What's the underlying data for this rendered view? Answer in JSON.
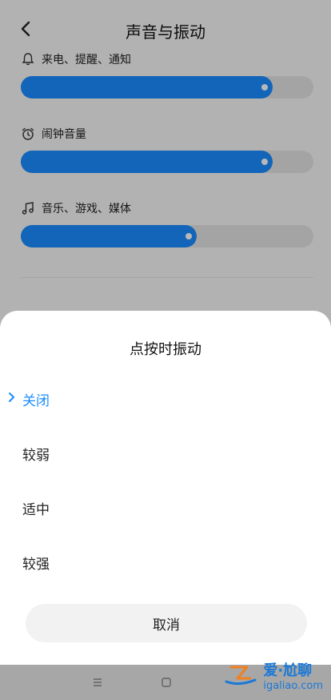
{
  "header": {
    "title": "声音与振动"
  },
  "volume_rows": [
    {
      "label": "来电、提醒、通知",
      "icon": "bell-icon",
      "level": 0.86
    },
    {
      "label": "闹钟音量",
      "icon": "alarm-clock-icon",
      "level": 0.86
    },
    {
      "label": "音乐、游戏、媒体",
      "icon": "music-note-icon",
      "level": 0.6
    }
  ],
  "sheet": {
    "title": "点按时振动",
    "options": [
      {
        "label": "关闭",
        "selected": true
      },
      {
        "label": "较弱",
        "selected": false
      },
      {
        "label": "适中",
        "selected": false
      },
      {
        "label": "较强",
        "selected": false
      }
    ],
    "cancel_label": "取消"
  },
  "watermark": {
    "text_cn": "爱·尬聊",
    "text_en": "igaliao.com"
  },
  "colors": {
    "accent": "#1a8cff",
    "watermark": "#1a78d6"
  }
}
